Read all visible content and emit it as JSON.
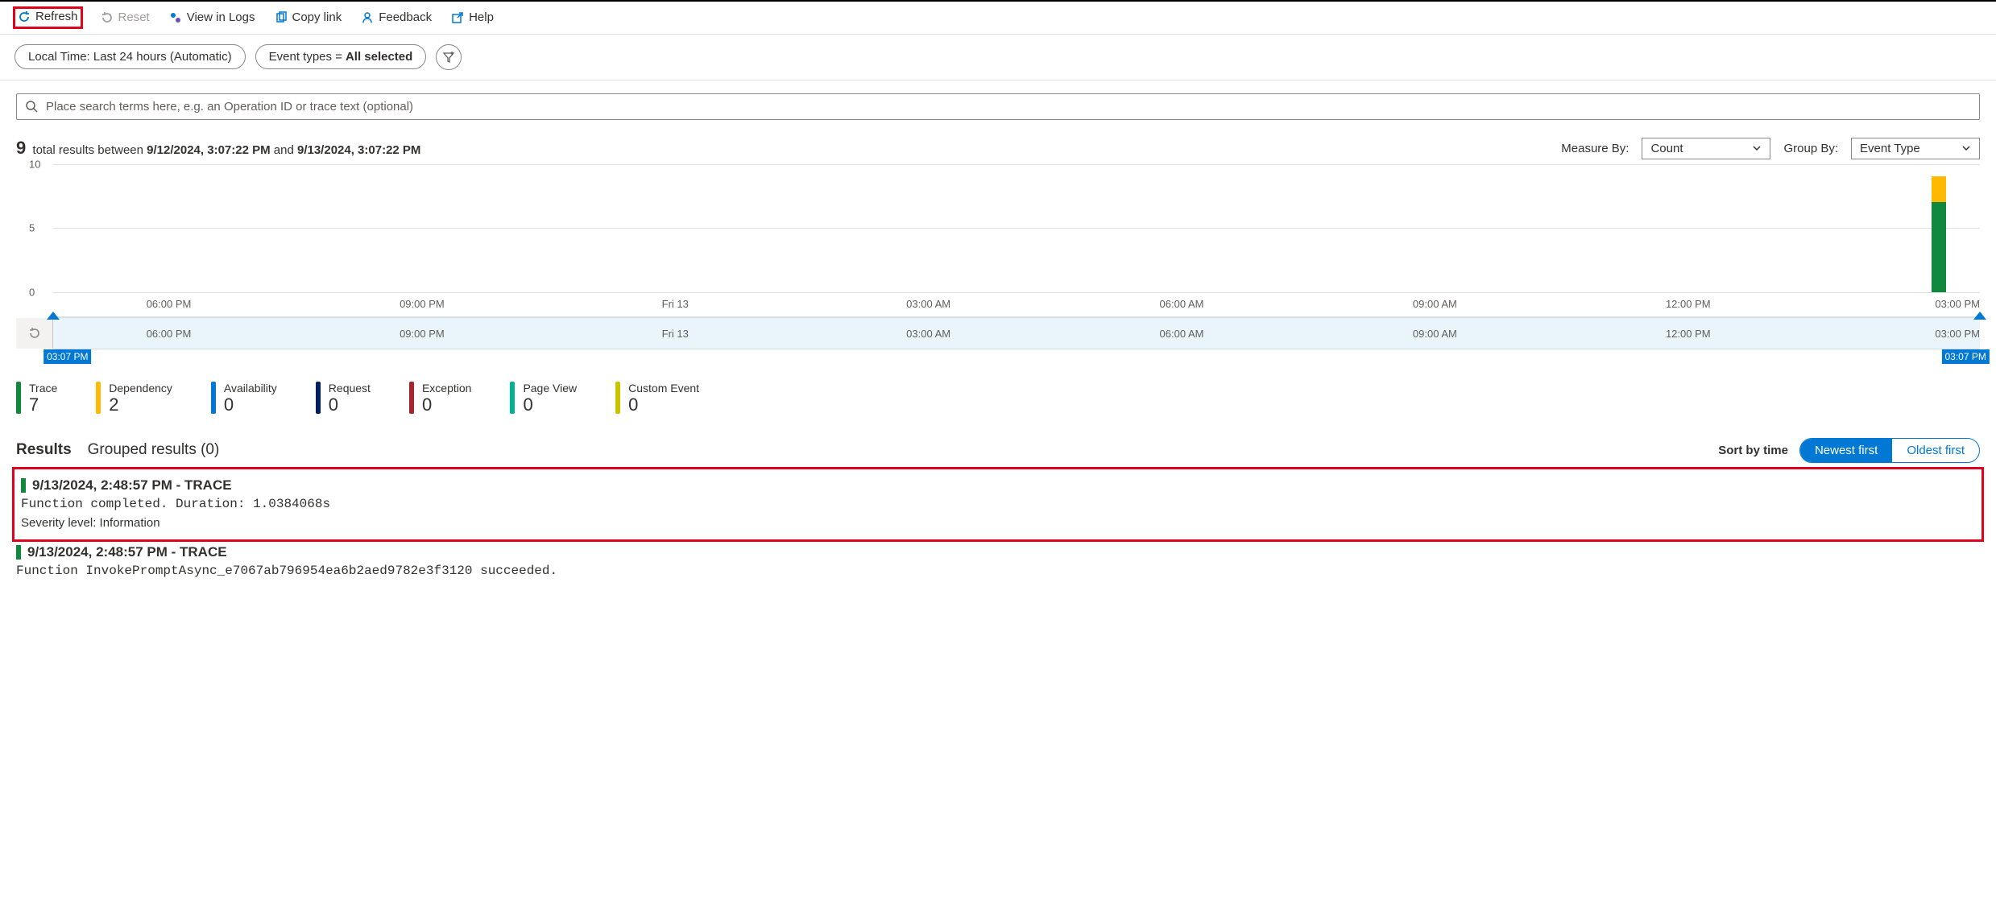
{
  "toolbar": {
    "refresh": "Refresh",
    "reset": "Reset",
    "view_in_logs": "View in Logs",
    "copy_link": "Copy link",
    "feedback": "Feedback",
    "help": "Help"
  },
  "filters": {
    "time_range": "Local Time: Last 24 hours (Automatic)",
    "event_types_prefix": "Event types = ",
    "event_types_value": "All selected"
  },
  "search": {
    "placeholder": "Place search terms here, e.g. an Operation ID or trace text (optional)"
  },
  "summary": {
    "total_count": "9",
    "between_text": " total results between ",
    "start_time": "9/12/2024, 3:07:22 PM",
    "and_text": " and ",
    "end_time": "9/13/2024, 3:07:22 PM"
  },
  "controls": {
    "measure_by_label": "Measure By:",
    "measure_by_value": "Count",
    "group_by_label": "Group By:",
    "group_by_value": "Event Type"
  },
  "chart_data": {
    "type": "bar",
    "stacked": true,
    "yticks": [
      0,
      5,
      10
    ],
    "ylim": [
      0,
      10
    ],
    "xticks_top": [
      "06:00 PM",
      "09:00 PM",
      "Fri 13",
      "03:00 AM",
      "06:00 AM",
      "09:00 AM",
      "12:00 PM",
      "03:00 PM"
    ],
    "xticks_bottom": [
      "06:00 PM",
      "09:00 PM",
      "Fri 13",
      "03:00 AM",
      "06:00 AM",
      "09:00 AM",
      "12:00 PM",
      "03:00 PM"
    ],
    "brush_start_label": "03:07 PM",
    "brush_end_label": "03:07 PM",
    "series": [
      {
        "name": "Trace",
        "color": "#10893e"
      },
      {
        "name": "Dependency",
        "color": "#ffb900"
      }
    ],
    "bars": [
      {
        "x_percent": 97.5,
        "segments": [
          {
            "series": "Trace",
            "value": 7
          },
          {
            "series": "Dependency",
            "value": 2
          }
        ]
      }
    ]
  },
  "legend": [
    {
      "label": "Trace",
      "count": "7",
      "color": "#10893e"
    },
    {
      "label": "Dependency",
      "count": "2",
      "color": "#ffb900"
    },
    {
      "label": "Availability",
      "count": "0",
      "color": "#0078d4"
    },
    {
      "label": "Request",
      "count": "0",
      "color": "#001f5f"
    },
    {
      "label": "Exception",
      "count": "0",
      "color": "#a4262c"
    },
    {
      "label": "Page View",
      "count": "0",
      "color": "#00b294"
    },
    {
      "label": "Custom Event",
      "count": "0",
      "color": "#c8c400"
    }
  ],
  "results_header": {
    "tab_results": "Results",
    "tab_grouped": "Grouped results (0)",
    "sort_label": "Sort by time",
    "newest": "Newest first",
    "oldest": "Oldest first"
  },
  "results": [
    {
      "timestamp": "9/13/2024, 2:48:57 PM",
      "sep": " - ",
      "type": "TRACE",
      "message": "Function completed. Duration: 1.0384068s",
      "severity": "Severity level: Information",
      "highlighted": true
    },
    {
      "timestamp": "9/13/2024, 2:48:57 PM",
      "sep": " - ",
      "type": "TRACE",
      "message": "Function InvokePromptAsync_e7067ab796954ea6b2aed9782e3f3120 succeeded.",
      "severity": "",
      "highlighted": false
    }
  ]
}
